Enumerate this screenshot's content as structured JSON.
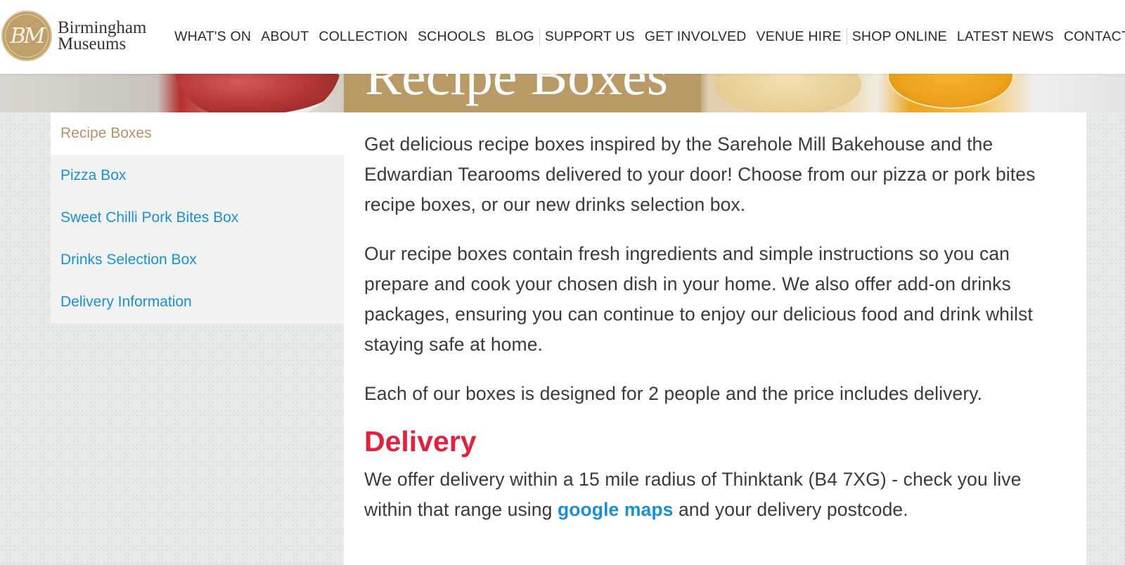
{
  "brand": {
    "seal": "BM",
    "name_line1": "Birmingham",
    "name_line2": "Museums"
  },
  "nav": [
    {
      "label": "WHAT'S ON"
    },
    {
      "label": "ABOUT"
    },
    {
      "label": "COLLECTION"
    },
    {
      "label": "SCHOOLS"
    },
    {
      "label": "BLOG"
    },
    {
      "label": "SUPPORT US"
    },
    {
      "label": "GET INVOLVED"
    },
    {
      "label": "VENUE HIRE"
    },
    {
      "label": "SHOP ONLINE"
    },
    {
      "label": "LATEST NEWS"
    },
    {
      "label": "CONTACT"
    }
  ],
  "hero": {
    "title": "Recipe Boxes"
  },
  "sidebar": {
    "items": [
      {
        "label": "Recipe Boxes",
        "active": true
      },
      {
        "label": "Pizza Box"
      },
      {
        "label": "Sweet Chilli Pork Bites Box"
      },
      {
        "label": "Drinks Selection Box"
      },
      {
        "label": "Delivery Information"
      }
    ]
  },
  "content": {
    "para1": "Get delicious recipe boxes inspired by the Sarehole Mill Bakehouse and the Edwardian Tearooms delivered to your door! Choose from our pizza or pork bites recipe boxes, or our new drinks selection box.",
    "para2": "Our recipe boxes contain fresh ingredients and simple instructions so you can prepare and cook your chosen dish in your home. We also offer add-on drinks packages, ensuring you can continue to enjoy our delicious food and drink whilst staying safe at home.",
    "para3": "Each of our boxes is designed for 2 people and the price includes delivery.",
    "delivery_heading": "Delivery",
    "para4_before": "We offer delivery within a 15 mile radius of Thinktank (B4 7XG) - check you live within that range using ",
    "para4_link": "google maps",
    "para4_after": " and your delivery postcode."
  },
  "colors": {
    "accent_gold": "#b99a67",
    "link_blue": "#1b8fd2",
    "heading_red": "#e0223f"
  }
}
